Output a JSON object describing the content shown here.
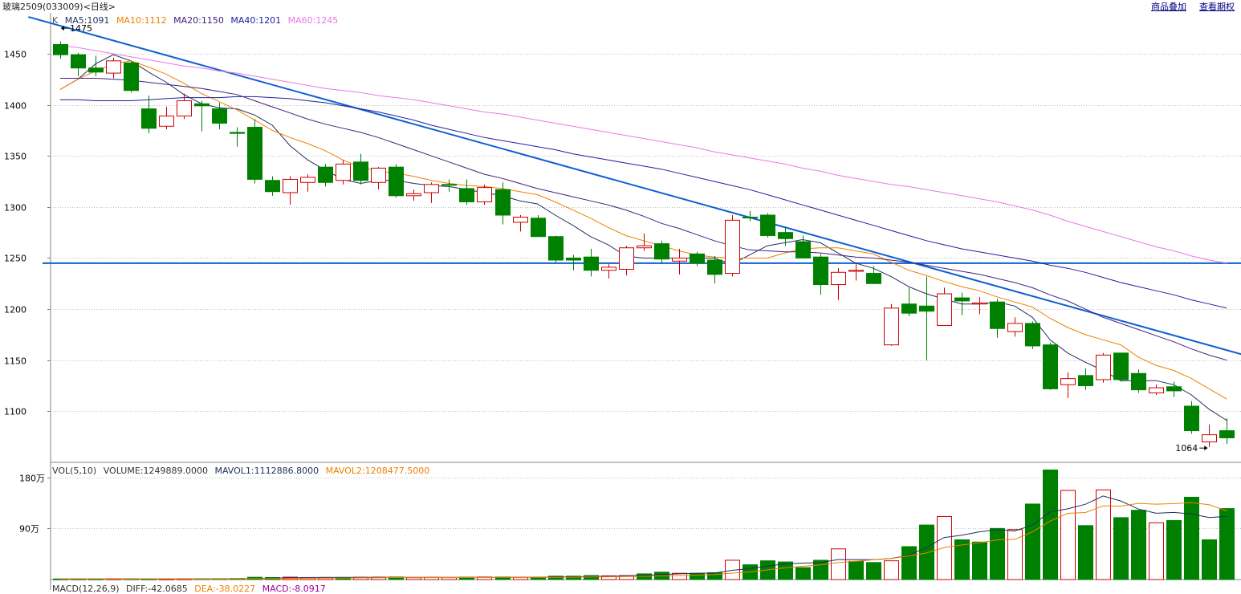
{
  "header": {
    "symbol": "玻璃2509(033009)<日线>",
    "overlay_link": "商品叠加",
    "options_link": "查看期权"
  },
  "price_legend": {
    "k_label": "K",
    "ma5": "MA5:1091",
    "ma10": "MA10:1112",
    "ma20": "MA20:1150",
    "ma40": "MA40:1201",
    "ma60": "MA60:1245"
  },
  "volume_legend": {
    "vol": "VOL(5,10)",
    "volume": "VOLUME:1249889.0000",
    "mavol1": "MAVOL1:1112886.8000",
    "mavol2": "MAVOL2:1208477.5000"
  },
  "macd_legend": {
    "macd_params": "MACD(12,26,9)",
    "diff": "DIFF:-42.0685",
    "dea": "DEA:-38.0227",
    "macd": "MACD:-8.0917"
  },
  "colors": {
    "up": "#cc0000",
    "down": "#008000",
    "ma5": "#1f2f5f",
    "ma10": "#f08000",
    "ma20": "#40207f",
    "ma40": "#2020a0",
    "ma60": "#e878e8",
    "trend": "#1060d0"
  },
  "annotations": {
    "high": "1475",
    "low": "1064"
  },
  "chart_data": [
    {
      "type": "candlestick",
      "title": "玻璃2509(033009)<日线>",
      "ylim": [
        1050,
        1490
      ],
      "yticks": [
        1100,
        1150,
        1200,
        1250,
        1300,
        1350,
        1400,
        1450
      ],
      "grid": true,
      "candles": [
        [
          1459,
          1462,
          1445,
          1449
        ],
        [
          1449,
          1451,
          1428,
          1436
        ],
        [
          1436,
          1448,
          1428,
          1432
        ],
        [
          1431,
          1446,
          1426,
          1443
        ],
        [
          1441,
          1443,
          1412,
          1414
        ],
        [
          1396,
          1409,
          1372,
          1377
        ],
        [
          1379,
          1398,
          1376,
          1389
        ],
        [
          1389,
          1411,
          1386,
          1404
        ],
        [
          1401,
          1404,
          1374,
          1399
        ],
        [
          1396,
          1402,
          1376,
          1382
        ],
        [
          1373,
          1378,
          1359,
          1372
        ],
        [
          1378,
          1386,
          1323,
          1327
        ],
        [
          1326,
          1330,
          1311,
          1315
        ],
        [
          1314,
          1330,
          1302,
          1327
        ],
        [
          1324,
          1332,
          1315,
          1329
        ],
        [
          1339,
          1342,
          1320,
          1324
        ],
        [
          1326,
          1346,
          1322,
          1342
        ],
        [
          1344,
          1352,
          1322,
          1326
        ],
        [
          1324,
          1339,
          1317,
          1338
        ],
        [
          1339,
          1342,
          1309,
          1311
        ],
        [
          1311,
          1317,
          1306,
          1313
        ],
        [
          1314,
          1324,
          1304,
          1322
        ],
        [
          1322,
          1327,
          1315,
          1322
        ],
        [
          1318,
          1327,
          1302,
          1305
        ],
        [
          1305,
          1322,
          1302,
          1319
        ],
        [
          1317,
          1324,
          1283,
          1292
        ],
        [
          1285,
          1292,
          1276,
          1290
        ],
        [
          1289,
          1292,
          1274,
          1271
        ],
        [
          1271,
          1272,
          1245,
          1248
        ],
        [
          1250,
          1253,
          1238,
          1248
        ],
        [
          1251,
          1259,
          1232,
          1238
        ],
        [
          1238,
          1244,
          1230,
          1241
        ],
        [
          1239,
          1262,
          1233,
          1260
        ],
        [
          1260,
          1274,
          1257,
          1262
        ],
        [
          1264,
          1267,
          1244,
          1249
        ],
        [
          1247,
          1259,
          1234,
          1250
        ],
        [
          1254,
          1256,
          1242,
          1245
        ],
        [
          1248,
          1252,
          1225,
          1234
        ],
        [
          1235,
          1292,
          1232,
          1287
        ],
        [
          1290,
          1296,
          1286,
          1290
        ],
        [
          1292,
          1294,
          1270,
          1272
        ],
        [
          1275,
          1280,
          1262,
          1269
        ],
        [
          1266,
          1272,
          1253,
          1250
        ],
        [
          1251,
          1254,
          1214,
          1224
        ],
        [
          1224,
          1240,
          1209,
          1236
        ],
        [
          1237,
          1245,
          1228,
          1238
        ],
        [
          1235,
          1242,
          1227,
          1225
        ],
        [
          1165,
          1205,
          1164,
          1201
        ],
        [
          1205,
          1221,
          1193,
          1196
        ],
        [
          1203,
          1232,
          1150,
          1198
        ],
        [
          1184,
          1221,
          1184,
          1215
        ],
        [
          1211,
          1216,
          1194,
          1208
        ],
        [
          1205,
          1212,
          1195,
          1206
        ],
        [
          1207,
          1210,
          1172,
          1181
        ],
        [
          1178,
          1192,
          1173,
          1186
        ],
        [
          1186,
          1188,
          1161,
          1164
        ],
        [
          1165,
          1167,
          1121,
          1122
        ],
        [
          1126,
          1138,
          1113,
          1132
        ],
        [
          1135,
          1142,
          1121,
          1125
        ],
        [
          1131,
          1157,
          1128,
          1155
        ],
        [
          1157,
          1157,
          1129,
          1131
        ],
        [
          1137,
          1141,
          1118,
          1121
        ],
        [
          1118,
          1126,
          1116,
          1123
        ],
        [
          1124,
          1129,
          1114,
          1120
        ],
        [
          1105,
          1110,
          1078,
          1081
        ],
        [
          1070,
          1087,
          1065,
          1077
        ],
        [
          1081,
          1093,
          1068,
          1074
        ]
      ],
      "series": [
        {
          "name": "MA5",
          "values": [
            1415,
            1425,
            1440,
            1449,
            1443,
            1432,
            1422,
            1410,
            1401,
            1397,
            1396,
            1390,
            1380,
            1360,
            1346,
            1336,
            1327,
            1323,
            1326,
            1326,
            1323,
            1321,
            1320,
            1317,
            1314,
            1311,
            1306,
            1303,
            1292,
            1282,
            1271,
            1263,
            1252,
            1250,
            1250,
            1250,
            1250,
            1250,
            1244,
            1253,
            1262,
            1265,
            1268,
            1265,
            1255,
            1245,
            1240,
            1232,
            1222,
            1215,
            1210,
            1205,
            1205,
            1207,
            1203,
            1192,
            1170,
            1157,
            1148,
            1140,
            1130,
            1130,
            1130,
            1126,
            1116,
            1102,
            1091
          ]
        },
        {
          "name": "MA10",
          "values": [
            1415,
            1425,
            1433,
            1440,
            1443,
            1437,
            1430,
            1421,
            1411,
            1403,
            1395,
            1385,
            1375,
            1368,
            1362,
            1355,
            1346,
            1339,
            1335,
            1333,
            1330,
            1326,
            1323,
            1321,
            1320,
            1318,
            1315,
            1312,
            1305,
            1297,
            1289,
            1280,
            1272,
            1267,
            1262,
            1257,
            1253,
            1251,
            1250,
            1250,
            1250,
            1255,
            1259,
            1260,
            1260,
            1257,
            1254,
            1246,
            1238,
            1233,
            1227,
            1222,
            1218,
            1212,
            1207,
            1202,
            1191,
            1182,
            1175,
            1170,
            1165,
            1153,
            1145,
            1140,
            1132,
            1122,
            1112
          ]
        },
        {
          "name": "MA20",
          "values": [
            1426,
            1426,
            1426,
            1425,
            1424,
            1422,
            1420,
            1418,
            1416,
            1413,
            1410,
            1404,
            1398,
            1392,
            1386,
            1381,
            1377,
            1373,
            1368,
            1362,
            1356,
            1350,
            1344,
            1338,
            1332,
            1328,
            1323,
            1318,
            1314,
            1310,
            1306,
            1302,
            1297,
            1291,
            1284,
            1279,
            1273,
            1267,
            1262,
            1258,
            1257,
            1256,
            1256,
            1255,
            1253,
            1251,
            1250,
            1248,
            1246,
            1243,
            1240,
            1237,
            1234,
            1230,
            1226,
            1221,
            1214,
            1208,
            1200,
            1192,
            1186,
            1180,
            1174,
            1168,
            1161,
            1155,
            1150
          ]
        },
        {
          "name": "MA40",
          "values": [
            1405,
            1405,
            1404,
            1404,
            1404,
            1405,
            1406,
            1407,
            1407,
            1407,
            1408,
            1408,
            1407,
            1406,
            1404,
            1402,
            1399,
            1396,
            1393,
            1389,
            1385,
            1380,
            1376,
            1372,
            1368,
            1365,
            1362,
            1359,
            1356,
            1352,
            1349,
            1346,
            1343,
            1340,
            1337,
            1333,
            1329,
            1325,
            1321,
            1317,
            1312,
            1307,
            1302,
            1297,
            1292,
            1287,
            1282,
            1277,
            1272,
            1267,
            1263,
            1259,
            1256,
            1253,
            1250,
            1247,
            1243,
            1240,
            1236,
            1231,
            1226,
            1222,
            1218,
            1214,
            1209,
            1205,
            1201
          ]
        },
        {
          "name": "MA60",
          "values": [
            1458,
            1456,
            1453,
            1450,
            1447,
            1444,
            1441,
            1438,
            1436,
            1433,
            1431,
            1428,
            1425,
            1422,
            1419,
            1416,
            1414,
            1412,
            1409,
            1407,
            1405,
            1402,
            1399,
            1396,
            1393,
            1391,
            1388,
            1385,
            1382,
            1379,
            1376,
            1373,
            1370,
            1367,
            1364,
            1361,
            1358,
            1354,
            1351,
            1348,
            1345,
            1342,
            1338,
            1335,
            1331,
            1328,
            1325,
            1322,
            1320,
            1317,
            1314,
            1311,
            1308,
            1305,
            1301,
            1297,
            1292,
            1286,
            1281,
            1276,
            1271,
            1266,
            1261,
            1257,
            1252,
            1248,
            1245
          ]
        }
      ],
      "trendlines": [
        {
          "from": [
            -1.8,
            1486
          ],
          "to": [
            67,
            1155
          ]
        },
        {
          "from": [
            -1,
            1245
          ],
          "to": [
            67,
            1245
          ]
        }
      ]
    },
    {
      "type": "bar",
      "title": "VOL(5,10)",
      "ylim": [
        0,
        2050000
      ],
      "yticks": [
        900000,
        1800000
      ],
      "ytick_labels": [
        "90万",
        "180万"
      ],
      "values": [
        10000,
        10000,
        10000,
        12000,
        12000,
        10000,
        10000,
        12000,
        14000,
        15000,
        18000,
        40000,
        36000,
        42000,
        36000,
        34000,
        38000,
        40000,
        42000,
        44000,
        33000,
        38000,
        34000,
        40000,
        44000,
        44000,
        40000,
        40000,
        60000,
        60000,
        70000,
        65000,
        70000,
        100000,
        130000,
        110000,
        110000,
        120000,
        340000,
        260000,
        330000,
        310000,
        210000,
        340000,
        540000,
        320000,
        300000,
        330000,
        580000,
        960000,
        1110000,
        700000,
        660000,
        900000,
        880000,
        1330000,
        1930000,
        1570000,
        950000,
        1580000,
        1090000,
        1220000,
        1000000,
        1040000,
        1450000,
        700000,
        1250000
      ],
      "directions": [
        "d",
        "d",
        "d",
        "u",
        "d",
        "d",
        "u",
        "u",
        "d",
        "d",
        "d",
        "d",
        "d",
        "u",
        "u",
        "u",
        "d",
        "u",
        "u",
        "d",
        "u",
        "u",
        "u",
        "d",
        "u",
        "d",
        "u",
        "d",
        "d",
        "d",
        "d",
        "u",
        "u",
        "d",
        "d",
        "u",
        "d",
        "d",
        "u",
        "d",
        "d",
        "d",
        "d",
        "d",
        "u",
        "d",
        "d",
        "u",
        "d",
        "d",
        "u",
        "d",
        "d",
        "d",
        "u",
        "d",
        "d",
        "u",
        "d",
        "u",
        "d",
        "d",
        "u",
        "d",
        "d",
        "d",
        "d"
      ],
      "series": [
        {
          "name": "MAVOL1",
          "values": [
            10000,
            10000,
            10000,
            10800,
            10800,
            10800,
            10800,
            11200,
            11600,
            12600,
            13800,
            19800,
            24600,
            30000,
            35000,
            38000,
            36800,
            38000,
            38400,
            40000,
            39400,
            39400,
            37800,
            38800,
            39400,
            40000,
            40000,
            40400,
            45600,
            48000,
            52000,
            58600,
            65200,
            75000,
            89000,
            101000,
            112000,
            114000,
            162000,
            192000,
            236000,
            276000,
            290000,
            298000,
            352000,
            352000,
            350000,
            372000,
            426000,
            564000,
            740000,
            782000,
            840000,
            880000,
            856000,
            960000,
            1190000,
            1246000,
            1326000,
            1472000,
            1384000,
            1242000,
            1168000,
            1182000,
            1156000,
            1092000,
            1112887
          ]
        },
        {
          "name": "MAVOL2",
          "values": [
            10000,
            10000,
            10000,
            10500,
            10800,
            10700,
            10600,
            10800,
            11200,
            11300,
            12100,
            15100,
            17700,
            20400,
            22800,
            24700,
            26800,
            29600,
            32000,
            34900,
            36400,
            36200,
            36000,
            35700,
            36500,
            37500,
            37700,
            37700,
            39500,
            41100,
            45700,
            48300,
            52000,
            57100,
            64500,
            71000,
            78000,
            86000,
            113000,
            133000,
            170000,
            206000,
            233000,
            257000,
            298000,
            323000,
            348000,
            369000,
            417000,
            467000,
            564000,
            609000,
            645000,
            699000,
            709000,
            839000,
            1028000,
            1166000,
            1180000,
            1298000,
            1294000,
            1342000,
            1328000,
            1338000,
            1353000,
            1318000,
            1208478
          ]
        }
      ]
    }
  ]
}
